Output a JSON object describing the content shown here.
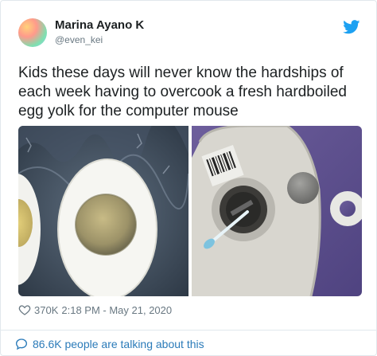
{
  "user": {
    "name": "Marina Ayano K",
    "handle": "@even_kei"
  },
  "tweet": {
    "text": "Kids these days will never know the hardships of\neach week having to overcook a fresh hardboiled\negg yolk for the computer mouse"
  },
  "meta": {
    "likes": "370K",
    "timestamp": "2:18 PM - May 21, 2020"
  },
  "footer": {
    "conversation": "86.6K people are talking about this"
  },
  "colors": {
    "link": "#2b7bb9",
    "twitter_blue": "#1da1f2",
    "muted": "#697882"
  },
  "icons": [
    "twitter-bird-icon",
    "heart-icon",
    "speech-bubble-icon"
  ]
}
